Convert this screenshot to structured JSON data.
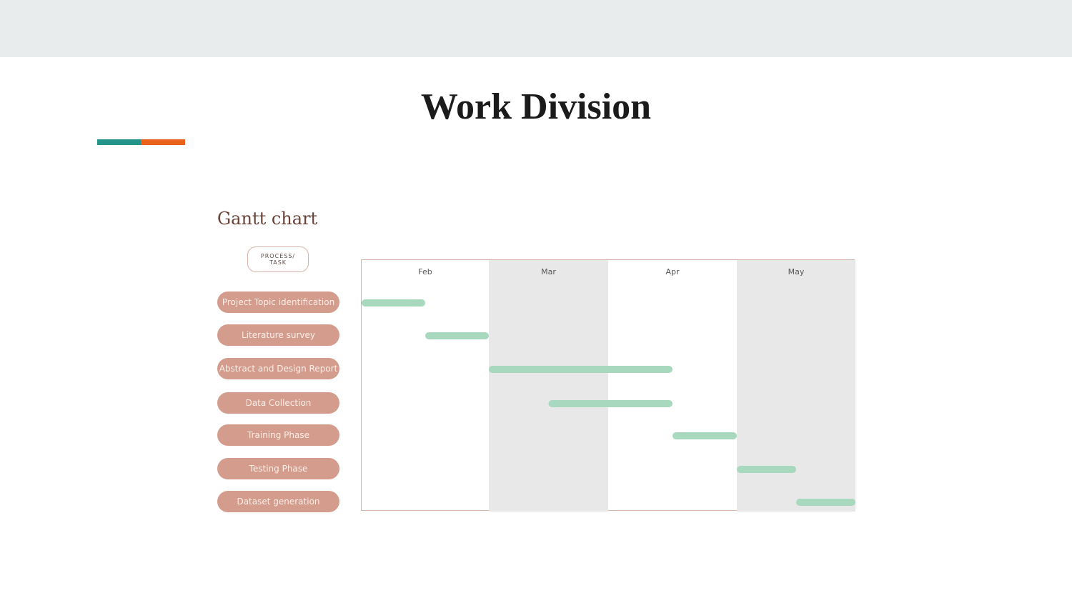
{
  "slide": {
    "title": "Work Division",
    "accent_colors": [
      "#24948a",
      "#e8621b"
    ],
    "top_band_color": "#e8ecec"
  },
  "chart_data": {
    "type": "gantt",
    "title": "Gantt chart",
    "task_column_header": "PROCESS/ TASK",
    "months": [
      "Feb",
      "Mar",
      "Apr",
      "May"
    ],
    "time_range": [
      0,
      4
    ],
    "tasks": [
      {
        "name": "Project Topic identification",
        "start": 0.0,
        "end": 0.5
      },
      {
        "name": "Literature survey",
        "start": 0.5,
        "end": 1.0
      },
      {
        "name": "Abstract and Design Report",
        "start": 1.0,
        "end": 2.5
      },
      {
        "name": "Data Collection",
        "start": 1.5,
        "end": 2.5
      },
      {
        "name": "Training Phase",
        "start": 2.5,
        "end": 3.0
      },
      {
        "name": "Testing Phase",
        "start": 3.0,
        "end": 3.5
      },
      {
        "name": "Dataset generation",
        "start": 3.5,
        "end": 4.0
      }
    ],
    "colors": {
      "bar": "#a8d8bd",
      "task_pill": "#d49c8c",
      "shaded_column": "#e8e8e8",
      "frame": "#d9b3a6"
    },
    "grid": false
  }
}
